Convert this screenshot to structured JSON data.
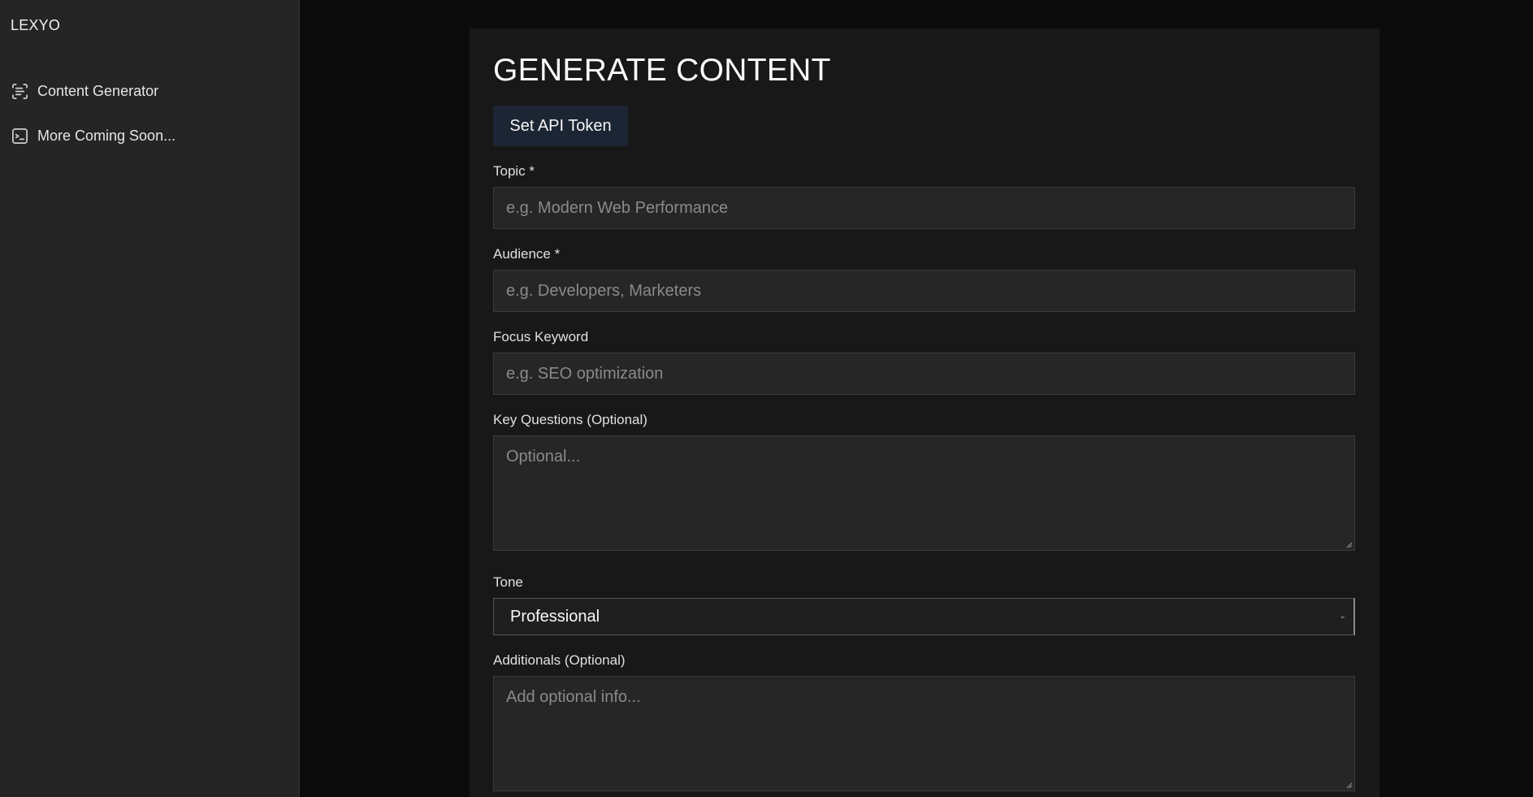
{
  "sidebar": {
    "brand": "LEXYO",
    "items": [
      {
        "label": "Content Generator",
        "icon": "scan-text-icon"
      },
      {
        "label": "More Coming Soon...",
        "icon": "terminal-square-icon"
      }
    ]
  },
  "main": {
    "title": "GENERATE CONTENT",
    "api_button": "Set API Token",
    "fields": {
      "topic": {
        "label": "Topic *",
        "placeholder": "e.g. Modern Web Performance",
        "value": ""
      },
      "audience": {
        "label": "Audience *",
        "placeholder": "e.g. Developers, Marketers",
        "value": ""
      },
      "focus_keyword": {
        "label": "Focus Keyword",
        "placeholder": "e.g. SEO optimization",
        "value": ""
      },
      "key_questions": {
        "label": "Key Questions (Optional)",
        "placeholder": "Optional...",
        "value": ""
      },
      "tone": {
        "label": "Tone",
        "selected": "Professional"
      },
      "additionals": {
        "label": "Additionals (Optional)",
        "placeholder": "Add optional info...",
        "value": ""
      }
    }
  },
  "colors": {
    "sidebar_bg": "#252525",
    "page_bg": "#0b0b0b",
    "panel_bg": "#181818",
    "input_bg": "#262626",
    "button_bg": "#1c2533"
  }
}
